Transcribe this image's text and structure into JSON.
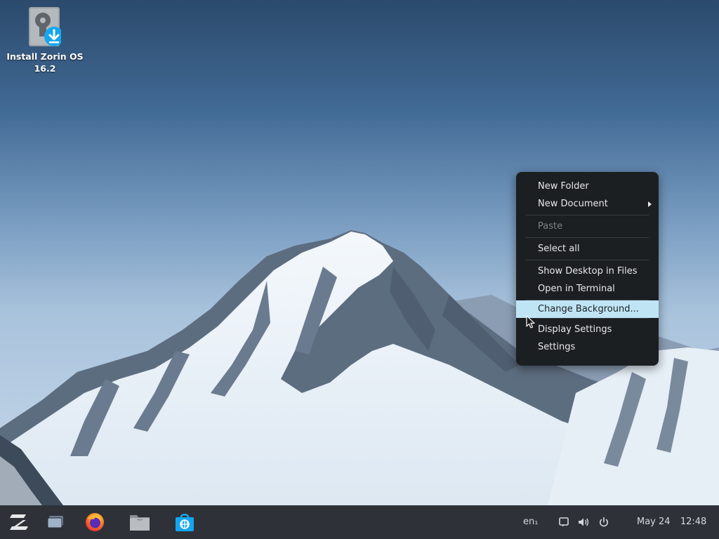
{
  "desktop": {
    "icons": [
      {
        "label_line1": "Install Zorin OS",
        "label_line2": "16.2",
        "icon": "install-zorin-os-icon"
      }
    ]
  },
  "context_menu": {
    "items": [
      {
        "label": "New Folder"
      },
      {
        "label": "New Document",
        "submenu": true
      },
      {
        "label": "Paste",
        "disabled": true
      },
      {
        "label": "Select all"
      },
      {
        "label": "Show Desktop in Files"
      },
      {
        "label": "Open in Terminal"
      },
      {
        "label": "Change Background...",
        "highlighted": true
      },
      {
        "label": "Display Settings"
      },
      {
        "label": "Settings"
      }
    ]
  },
  "taskbar": {
    "launchers": [
      {
        "name": "zorin-menu-icon"
      },
      {
        "name": "window-switcher-icon"
      },
      {
        "name": "firefox-icon"
      },
      {
        "name": "files-icon"
      },
      {
        "name": "software-store-icon"
      }
    ],
    "keyboard_layout": "en₁",
    "tray_icons": [
      "notifications-icon",
      "volume-icon",
      "power-icon"
    ],
    "date": "May 24",
    "time": "12:48"
  },
  "colors": {
    "menu_bg": "#1c1f22",
    "menu_highlight": "#bfe5f5",
    "taskbar_bg": "#2e3238",
    "accent": "#15a6f0"
  }
}
